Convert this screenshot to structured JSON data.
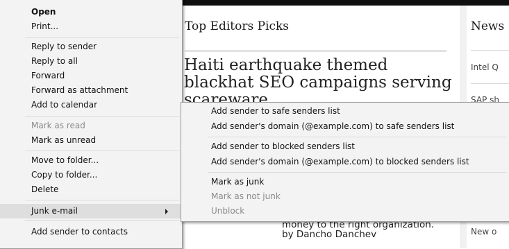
{
  "page": {
    "picks_title": "Top Editors Picks",
    "headline": "Haiti earthquake themed blackhat SEO campaigns serving scareware",
    "story_text": "money to the right organization. by Dancho Danchev",
    "news_title": "News",
    "news_items": [
      "Intel Q",
      "SAP sh",
      "New o"
    ]
  },
  "context_menu": {
    "items": [
      {
        "label": "Open",
        "bold": true
      },
      {
        "label": "Print..."
      },
      {
        "label": "Reply to sender"
      },
      {
        "label": "Reply to all"
      },
      {
        "label": "Forward"
      },
      {
        "label": "Forward as attachment"
      },
      {
        "label": "Add to calendar"
      },
      {
        "label": "Mark as read",
        "disabled": true
      },
      {
        "label": "Mark as unread"
      },
      {
        "label": "Move to folder..."
      },
      {
        "label": "Copy to folder..."
      },
      {
        "label": "Delete"
      },
      {
        "label": "Junk e-mail",
        "submenu": true,
        "highlighted": true
      },
      {
        "label": "Add sender to contacts"
      }
    ]
  },
  "junk_submenu": {
    "items": [
      {
        "label": "Add sender to safe senders list"
      },
      {
        "label": "Add sender's domain (@example.com) to safe senders list"
      },
      {
        "label": "Add sender to blocked senders list"
      },
      {
        "label": "Add sender's domain (@example.com) to blocked senders list"
      },
      {
        "label": "Mark as junk"
      },
      {
        "label": "Mark as not junk",
        "disabled": true
      },
      {
        "label": "Unblock",
        "disabled": true
      }
    ]
  },
  "colors": {
    "menu_background": "#f3f3f3",
    "menu_border": "#9a9a9a",
    "disabled_text": "#8a8a8a",
    "highlight": "#dedede"
  }
}
